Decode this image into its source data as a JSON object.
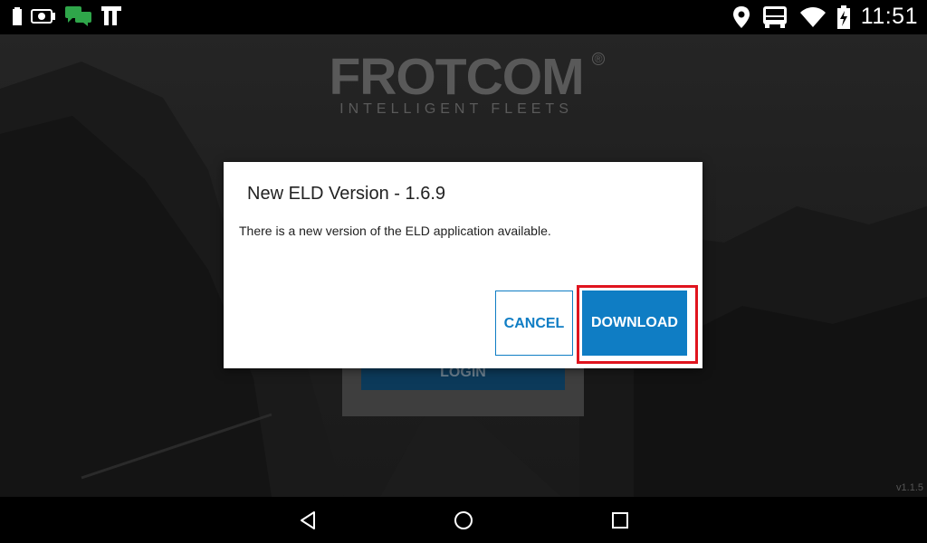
{
  "status_bar": {
    "time": "11:51",
    "left_icons": [
      "battery-icon",
      "camera-icon",
      "chat-icon",
      "app-t-icon"
    ],
    "right_icons": [
      "location-icon",
      "truck-icon",
      "wifi-icon",
      "battery-charging-icon"
    ]
  },
  "background": {
    "logo_title": "FROTCOM",
    "logo_registered": "®",
    "logo_tagline": "INTELLIGENT FLEETS",
    "login_label": "LOGIN",
    "version": "v1.1.5"
  },
  "dialog": {
    "title": "New ELD Version - 1.6.9",
    "message": "There is a new version of the ELD application available.",
    "cancel_label": "CANCEL",
    "download_label": "DOWNLOAD"
  },
  "nav_bar": {
    "buttons": [
      "back-icon",
      "home-icon",
      "recents-icon"
    ]
  },
  "colors": {
    "accent": "#0f7dc4",
    "highlight": "#e0141e"
  }
}
